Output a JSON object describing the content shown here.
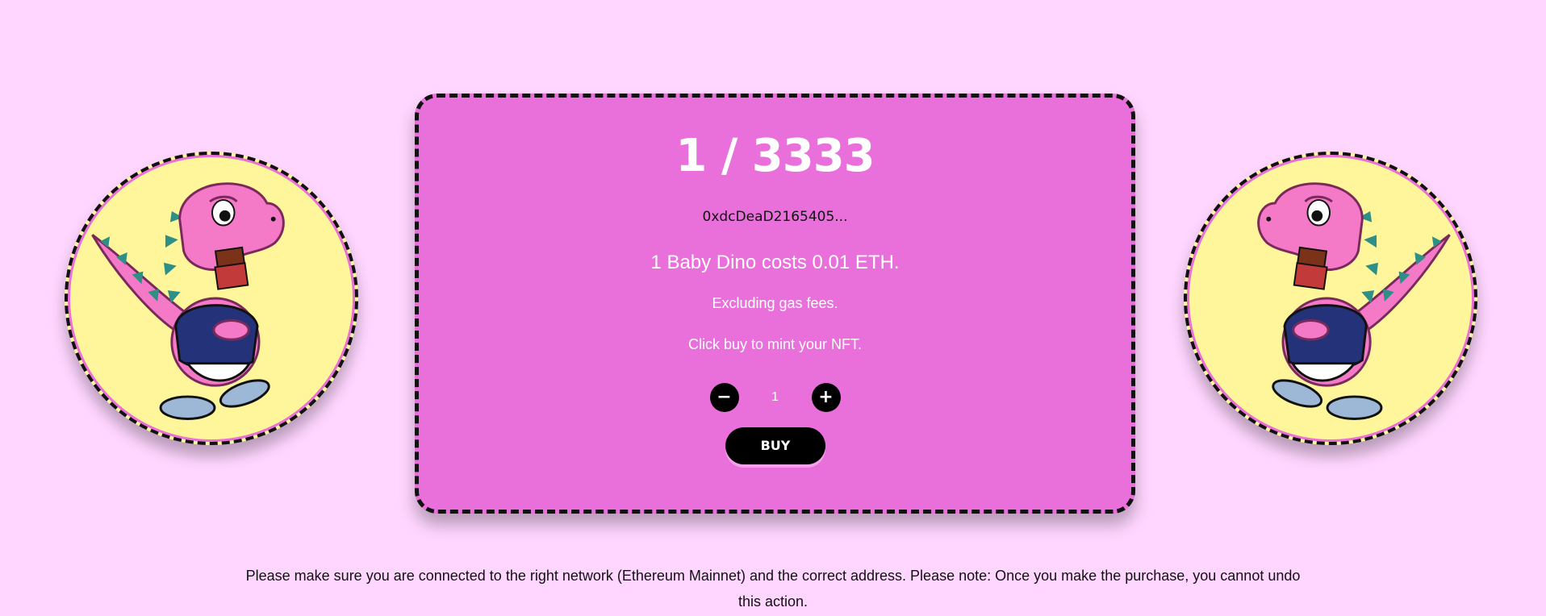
{
  "mint": {
    "supply": "1 / 3333",
    "address": "0xdcDeaD2165405...",
    "cost_text": "1 Baby Dino costs 0.01 ETH.",
    "gas_text": "Excluding gas fees.",
    "hint_text": "Click buy to mint your NFT.",
    "decrement_label": "−",
    "quantity": "1",
    "increment_label": "+",
    "buy_label": "BUY"
  },
  "disclaimer": "Please make sure you are connected to the right network (Ethereum Mainnet) and the correct address. Please note: Once you make the purchase, you cannot undo this action.",
  "colors": {
    "page_background": "#ffd6ff",
    "card_background": "#e970da",
    "circle_background": "#fff59a",
    "button": "#000000"
  },
  "icons": {
    "left_image": "baby-dino-mascot",
    "right_image": "baby-dino-mascot"
  }
}
